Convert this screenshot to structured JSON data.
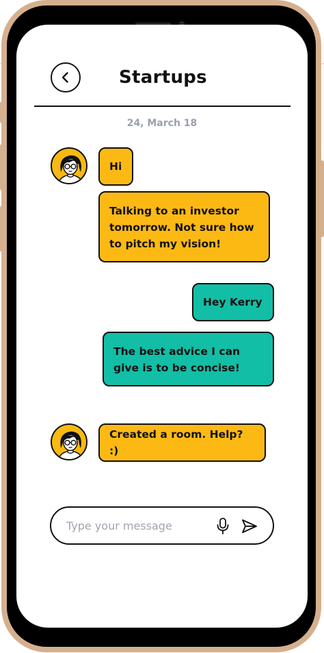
{
  "header": {
    "title": "Startups",
    "back_icon": "chevron-left-icon"
  },
  "conversation": {
    "date": "24, March 18",
    "messages": [
      {
        "direction": "incoming",
        "text": "Hi"
      },
      {
        "direction": "incoming",
        "text": "Talking to an investor tomorrow. Not sure how to pitch my vision!"
      },
      {
        "direction": "outgoing",
        "text": "Hey Kerry"
      },
      {
        "direction": "outgoing",
        "text": "The best advice I can give is to be concise!"
      },
      {
        "direction": "incoming",
        "text": "Created a room. Help? :)"
      }
    ]
  },
  "composer": {
    "placeholder": "Type your message",
    "value": "",
    "mic_icon": "microphone-icon",
    "send_icon": "send-icon"
  },
  "colors": {
    "incoming_bubble": "#fdb913",
    "outgoing_bubble": "#12bea6",
    "frame": "#d5b08e",
    "avatar_bg": "#f7b912"
  }
}
